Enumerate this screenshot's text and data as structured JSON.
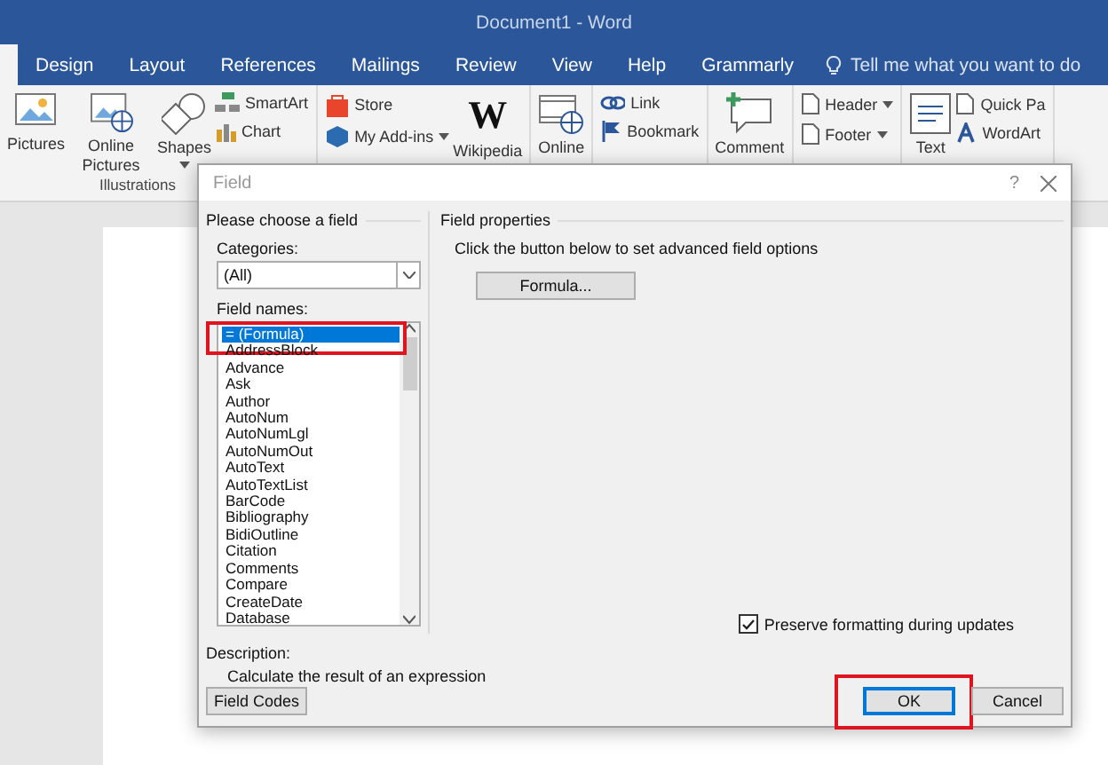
{
  "window": {
    "title": "Document1 - Word"
  },
  "tabs": [
    {
      "label": "Design",
      "selected": false
    },
    {
      "label": "Layout",
      "selected": false
    },
    {
      "label": "References",
      "selected": false
    },
    {
      "label": "Mailings",
      "selected": false
    },
    {
      "label": "Review",
      "selected": false
    },
    {
      "label": "View",
      "selected": false
    },
    {
      "label": "Help",
      "selected": false
    },
    {
      "label": "Grammarly",
      "selected": false
    }
  ],
  "tell_me": {
    "placeholder": "Tell me what you want to do"
  },
  "ribbon": {
    "groups": [
      {
        "label": "Illustrations",
        "items": [
          {
            "kind": "large",
            "label": "Pictures"
          },
          {
            "kind": "large",
            "label": "Online Pictures"
          },
          {
            "kind": "large",
            "label": "Shapes",
            "dropdown": true
          },
          {
            "kind": "small",
            "label": "SmartArt"
          },
          {
            "kind": "small",
            "label": "Chart"
          }
        ]
      },
      {
        "items": [
          {
            "kind": "small",
            "label": "Store"
          },
          {
            "kind": "small",
            "label": "My Add-ins",
            "dropdown": true
          },
          {
            "kind": "large",
            "label": "Wikipedia",
            "logo": "W"
          }
        ]
      },
      {
        "items": [
          {
            "kind": "large",
            "label": "Online"
          }
        ]
      },
      {
        "items": [
          {
            "kind": "small",
            "label": "Link"
          },
          {
            "kind": "small",
            "label": "Bookmark"
          }
        ]
      },
      {
        "items": [
          {
            "kind": "large",
            "label": "Comment"
          }
        ]
      },
      {
        "items": [
          {
            "kind": "small",
            "label": "Header",
            "dropdown": true
          },
          {
            "kind": "small",
            "label": "Footer",
            "dropdown": true
          }
        ]
      },
      {
        "items": [
          {
            "kind": "large",
            "label": "Text"
          },
          {
            "kind": "small",
            "label": "Quick Pa"
          },
          {
            "kind": "small",
            "label": "WordArt"
          }
        ]
      }
    ]
  },
  "dialog": {
    "title": "Field",
    "help": "?",
    "left": {
      "heading": "Please choose a field",
      "categories_label": "Categories:",
      "category": "(All)",
      "field_names_label": "Field names:",
      "field_names": [
        {
          "label": "= (Formula)",
          "selected": true,
          "highlighted": true
        },
        {
          "label": "AddressBlock",
          "selected": false
        },
        {
          "label": "Advance",
          "selected": false
        },
        {
          "label": "Ask",
          "selected": false
        },
        {
          "label": "Author",
          "selected": false
        },
        {
          "label": "AutoNum",
          "selected": false
        },
        {
          "label": "AutoNumLgl",
          "selected": false
        },
        {
          "label": "AutoNumOut",
          "selected": false
        },
        {
          "label": "AutoText",
          "selected": false
        },
        {
          "label": "AutoTextList",
          "selected": false
        },
        {
          "label": "BarCode",
          "selected": false
        },
        {
          "label": "Bibliography",
          "selected": false
        },
        {
          "label": "BidiOutline",
          "selected": false
        },
        {
          "label": "Citation",
          "selected": false
        },
        {
          "label": "Comments",
          "selected": false
        },
        {
          "label": "Compare",
          "selected": false
        },
        {
          "label": "CreateDate",
          "selected": false
        },
        {
          "label": "Database",
          "selected": false
        }
      ],
      "description_label": "Description:",
      "description": "Calculate the result of an expression",
      "field_codes_button": "Field Codes"
    },
    "right": {
      "heading": "Field properties",
      "hint": "Click the button below to set advanced field options",
      "formula_button": "Formula...",
      "preserve_formatting": {
        "label": "Preserve formatting during updates",
        "checked": true
      }
    },
    "buttons": [
      {
        "label": "OK",
        "default": true,
        "highlighted": true
      },
      {
        "label": "Cancel",
        "default": false
      }
    ]
  }
}
